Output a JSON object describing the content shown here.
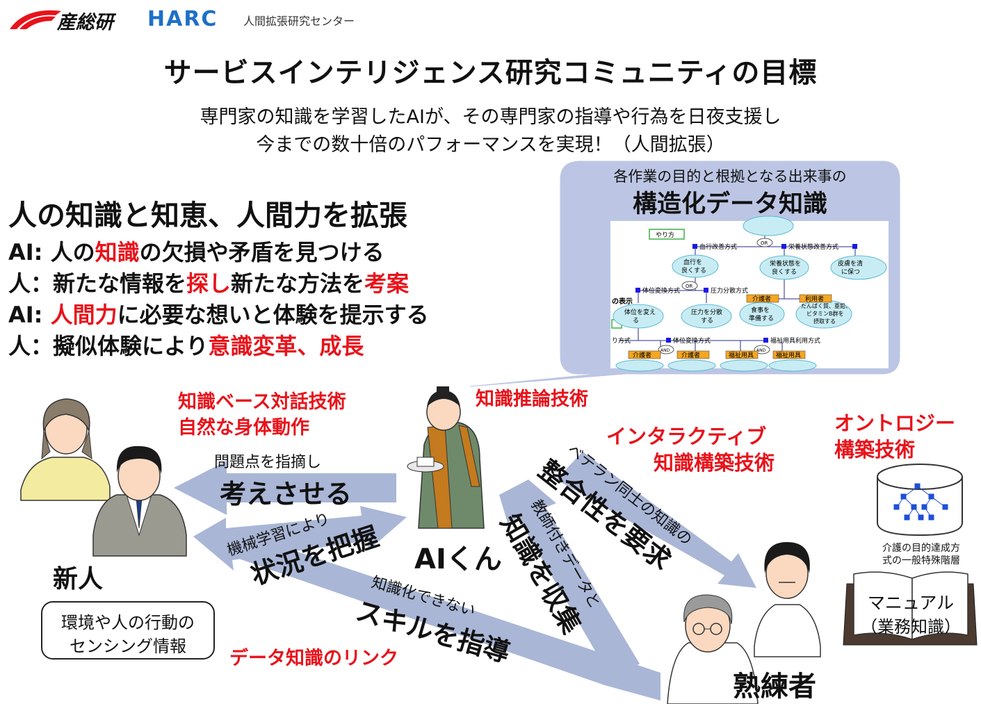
{
  "header": {
    "logo_aist_text": "産総研",
    "logo_harc_text": "HARC",
    "org_name": "人間拡張研究センター"
  },
  "title": "サービスインテリジェンス研究コミュニティの目標",
  "subtitle": {
    "line1": "専門家の知識を学習したAIが、その専門家の指導や行為を日夜支援し",
    "line2": "今までの数十倍のパフォーマンスを実現！（人間拡張）"
  },
  "goals": {
    "heading": "人の知識と知恵、人間力を拡張",
    "rows": [
      {
        "prefix": "AI: 人の",
        "highlight": "知識",
        "suffix": "の欠損や矛盾を見つける"
      },
      {
        "prefix": "人：新たな情報を",
        "highlight": "探し",
        "suffix": "新たな方法を",
        "highlight2": "考案"
      },
      {
        "prefix": "AI: ",
        "highlight": "人間力",
        "suffix": "に必要な想いと体験を提示する"
      },
      {
        "prefix": "人：擬似体験により",
        "highlight": "意識変革、成長",
        "suffix": ""
      }
    ]
  },
  "bubble": {
    "caption": "各作業の目的と根拠となる出来事の",
    "title": "構造化データ知識",
    "tree": {
      "nodes": [
        "やり方",
        "血行改善方式",
        "栄養状態改善方式",
        "血行を良くする",
        "栄養状態を良くする",
        "皮膚を清潔に保つ",
        "体位変換方式",
        "圧力分散方式",
        "の表示",
        "体位を変える",
        "圧力を分散する",
        "介護者",
        "利用者",
        "食事を準備する",
        "たんぱく質、亜鉛、ビタミンB群を摂取する",
        "り方式",
        "体位変換方式",
        "福祉用具利用方式",
        "介護者",
        "介護者",
        "福祉用具",
        "福祉用具",
        "OR",
        "OR",
        "AND",
        "AND"
      ]
    }
  },
  "techs": {
    "dialog": "知識ベース対話技術",
    "motion": "自然な身体動作",
    "inference": "知識推論技術",
    "interactive_1": "インタラクティブ",
    "interactive_2": "知識構築技術",
    "ontology_1": "オントロジー",
    "ontology_2": "構築技術",
    "data_link": "データ知識のリンク"
  },
  "arrows": {
    "think_small": "問題点を指摘し",
    "think_big": "考えさせる",
    "ml_small": "機械学習により",
    "ml_big": "状況を把握",
    "skill_small": "知識化できない",
    "skill_big": "スキルを指導",
    "collect_small": "教師付きデータと",
    "collect_big": "知識を収集",
    "consistency_small": "ベテラン同士の知識の",
    "consistency_big": "整合性を要求"
  },
  "labels": {
    "newcomer": "新人",
    "ai": "AIくん",
    "expert": "熟練者",
    "sensing_1": "環境や人の行動の",
    "sensing_2": "センシング情報",
    "ontology_caption_1": "介護の目的達成方",
    "ontology_caption_2": "式の一般特殊階層",
    "manual_1": "マニュアル",
    "manual_2": "（業務知識）"
  },
  "colors": {
    "accent_red": "#e8131b",
    "arrow_fill": "#a9b6d6",
    "bubble_fill": "#bcc6e4",
    "tree_node_fill": "#c8ecf4",
    "tree_node_stroke": "#5bb8d3",
    "tree_square": "#1a1ae6",
    "tree_label_fill": "#f5a623",
    "harc_blue": "#1e6fc8"
  }
}
